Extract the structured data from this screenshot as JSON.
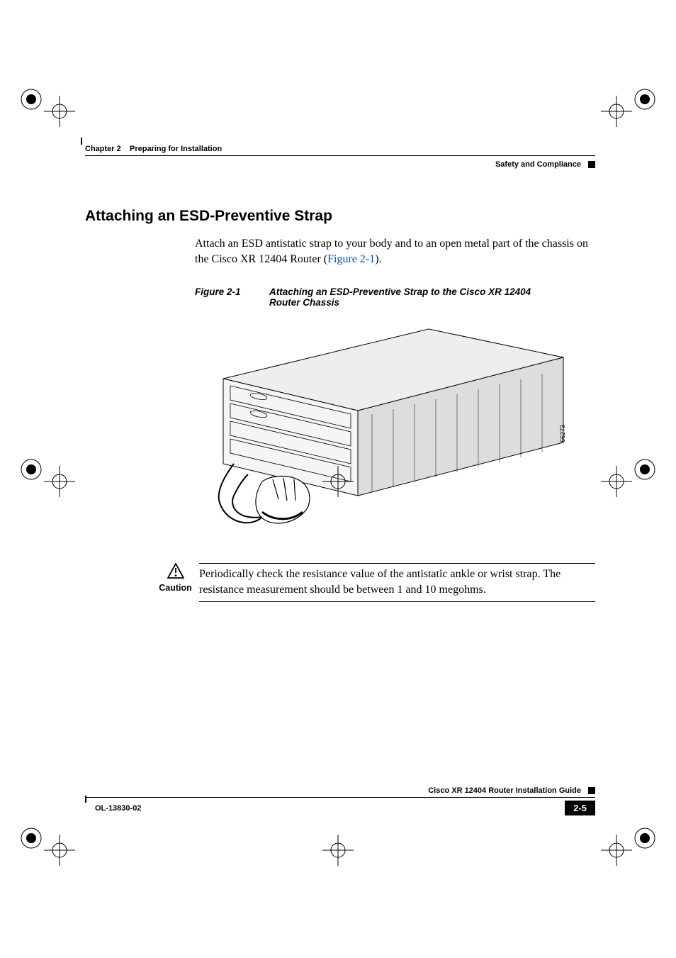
{
  "header": {
    "chapter_label": "Chapter 2",
    "chapter_title": "Preparing for Installation",
    "section_label": "Safety and Compliance"
  },
  "section": {
    "heading": "Attaching an ESD-Preventive Strap",
    "paragraph_pre": "Attach an ESD antistatic strap to your body and to an open metal part of the chassis on the Cisco XR 12404 Router (",
    "paragraph_link": "Figure 2-1",
    "paragraph_post": ")."
  },
  "figure": {
    "number": "Figure 2-1",
    "title": "Attaching an ESD-Preventive Strap to the Cisco XR 12404 Router Chassis",
    "artwork_id": "66273",
    "description": "Line drawing of a Cisco XR 12404 rack-mount router chassis shown in three-quarter view. A hand with an ESD wrist strap is shown below the front-left of the chassis; the strap's coiled cord is clipped to a metal grounding point on the chassis front."
  },
  "caution": {
    "label": "Caution",
    "text": "Periodically check the resistance value of the antistatic ankle or wrist strap. The resistance measurement should be between 1 and 10 megohms."
  },
  "footer": {
    "guide_title": "Cisco XR 12404 Router Installation Guide",
    "doc_id": "OL-13830-02",
    "page_number": "2-5"
  }
}
